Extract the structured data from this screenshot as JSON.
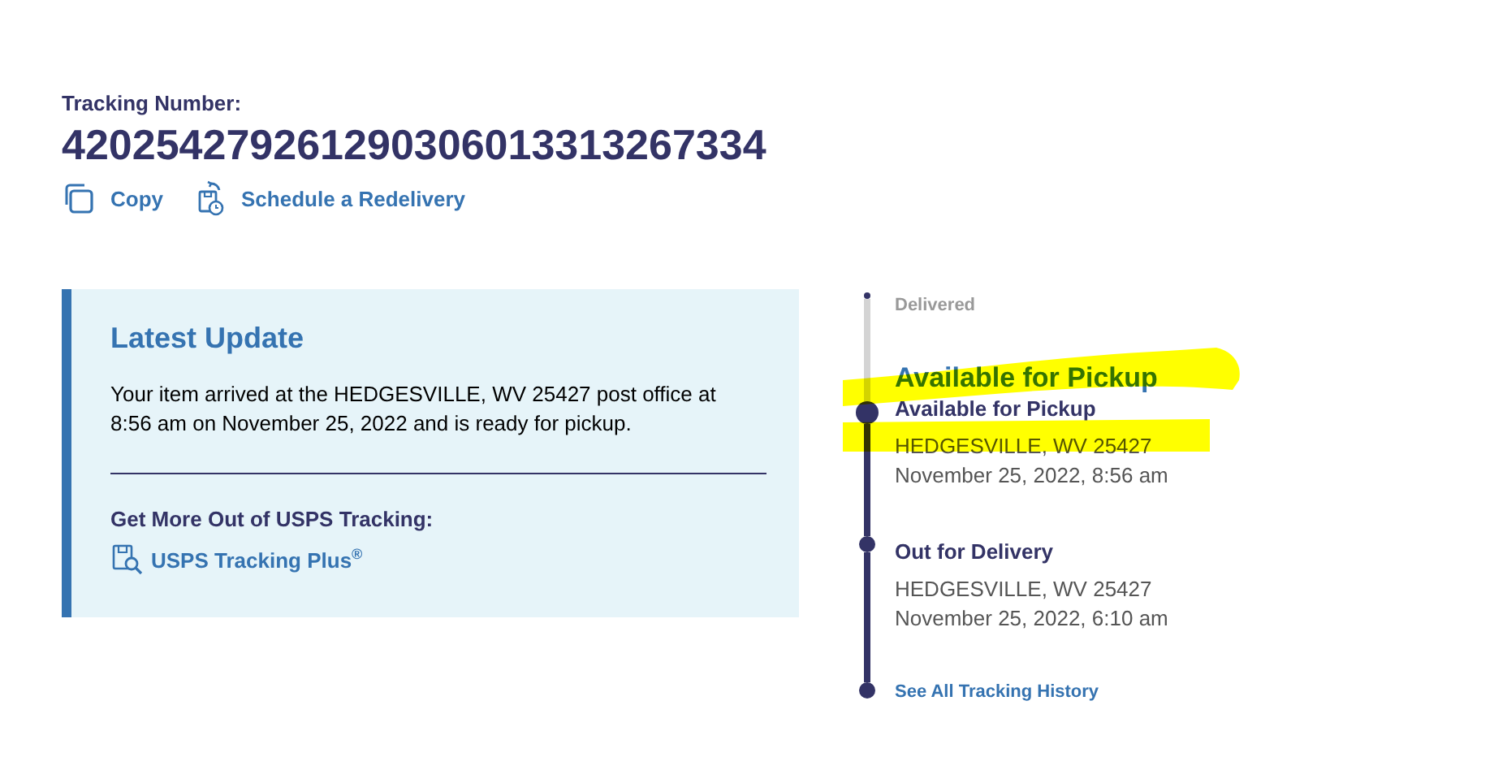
{
  "tracking": {
    "label": "Tracking Number:",
    "number": "420254279261290306013313267334"
  },
  "actions": [
    {
      "kind": "copy",
      "label": "Copy"
    },
    {
      "kind": "redelivery",
      "label": "Schedule a Redelivery"
    }
  ],
  "latest_update": {
    "title": "Latest Update",
    "message": "Your item arrived at the HEDGESVILLE, WV 25427 post office at 8:56 am on November 25, 2022 and is ready for pickup.",
    "promo_label": "Get More Out of USPS Tracking:",
    "promo_link": "USPS Tracking Plus$^{®}$"
  },
  "timeline": {
    "upcoming": "Delivered",
    "status": {
      "title": "Available for Pickup",
      "highlighted": true
    },
    "events": [
      {
        "title": "Available for Pickup",
        "location": "HEDGESVILLE, WV 25427",
        "time": "November 25, 2022, 8:56 am",
        "current": true,
        "location_highlighted": true
      },
      {
        "title": "Out for Delivery",
        "location": "HEDGESVILLE, WV 25427",
        "time": "November 25, 2022, 6:10 am",
        "current": false,
        "location_highlighted": false
      }
    ],
    "history_link": "See All Tracking History"
  }
}
